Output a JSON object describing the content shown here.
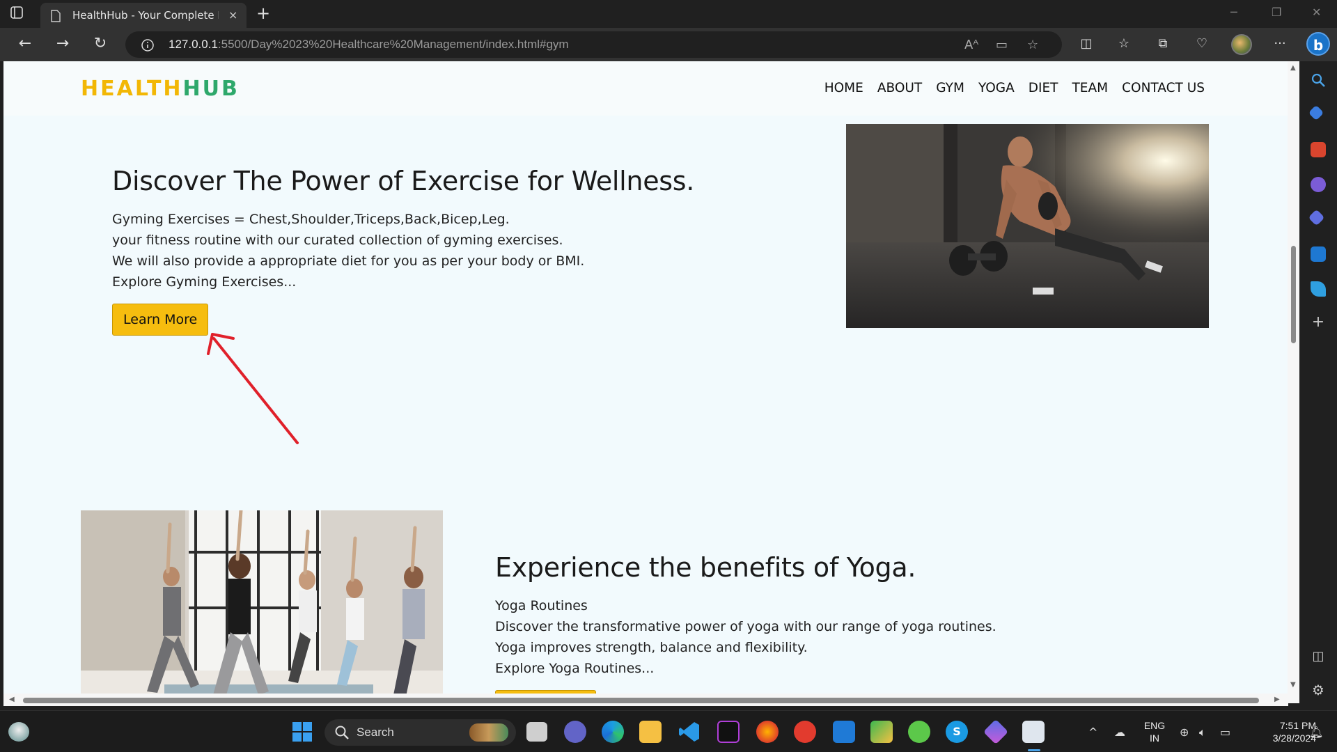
{
  "browser": {
    "tab_title": "HealthHub - Your Complete Heal",
    "url_host": "127.0.0.1",
    "url_path": ":5500/Day%2023%20Healthcare%20Management/index.html#gym",
    "new_tab_symbol": "+",
    "close_symbol": "×",
    "more_symbol": "···"
  },
  "site": {
    "logo_part1": "HEALTH",
    "logo_part2": "HUB",
    "menu": [
      "HOME",
      "ABOUT",
      "GYM",
      "YOGA",
      "DIET",
      "TEAM",
      "CONTACT US"
    ]
  },
  "gym": {
    "heading": "Discover The Power of Exercise for Wellness.",
    "lines": [
      "Gyming Exercises = Chest,Shoulder,Triceps,Back,Bicep,Leg.",
      "your fitness routine with our curated collection of gyming exercises.",
      "We will also provide a appropriate diet for you as per your body or BMI.",
      "Explore Gyming Exercises..."
    ],
    "button": "Learn More"
  },
  "yoga": {
    "heading": "Experience the benefits of Yoga.",
    "lines": [
      "Yoga Routines",
      "Discover the transformative power of yoga with our range of yoga routines.",
      "Yoga improves strength, balance and flexibility.",
      "Explore Yoga Routines..."
    ]
  },
  "taskbar": {
    "search_label": "Search",
    "lang_line1": "ENG",
    "lang_line2": "IN",
    "time": "7:51 PM",
    "date": "3/28/2024"
  },
  "colors": {
    "logo_yellow": "#f2b705",
    "logo_green": "#2ea86b",
    "button_yellow": "#f6bd0f",
    "page_bg": "#f2fafd",
    "annotation_red": "#e0202a"
  }
}
